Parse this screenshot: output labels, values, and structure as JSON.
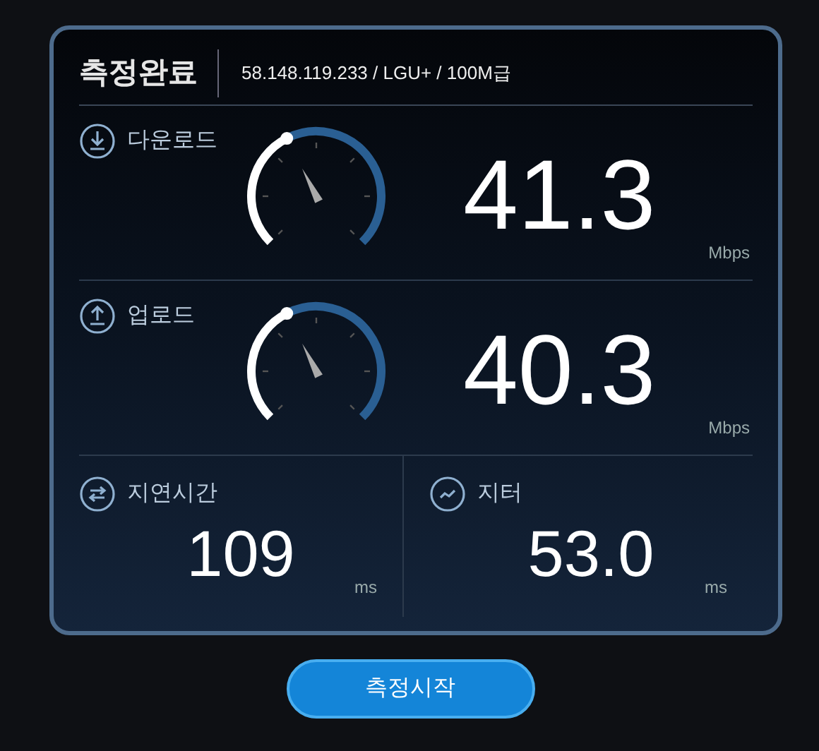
{
  "header": {
    "title": "측정완료",
    "info": "58.148.119.233 / LGU+ / 100M급"
  },
  "speeds": [
    {
      "kind": "download",
      "label": "다운로드",
      "value": "41.3",
      "unit": "Mbps"
    },
    {
      "kind": "upload",
      "label": "업로드",
      "value": "40.3",
      "unit": "Mbps"
    }
  ],
  "metrics": [
    {
      "kind": "latency",
      "label": "지연시간",
      "value": "109",
      "unit": "ms"
    },
    {
      "kind": "jitter",
      "label": "지터",
      "value": "53.0",
      "unit": "ms"
    }
  ],
  "button": "측정시작"
}
